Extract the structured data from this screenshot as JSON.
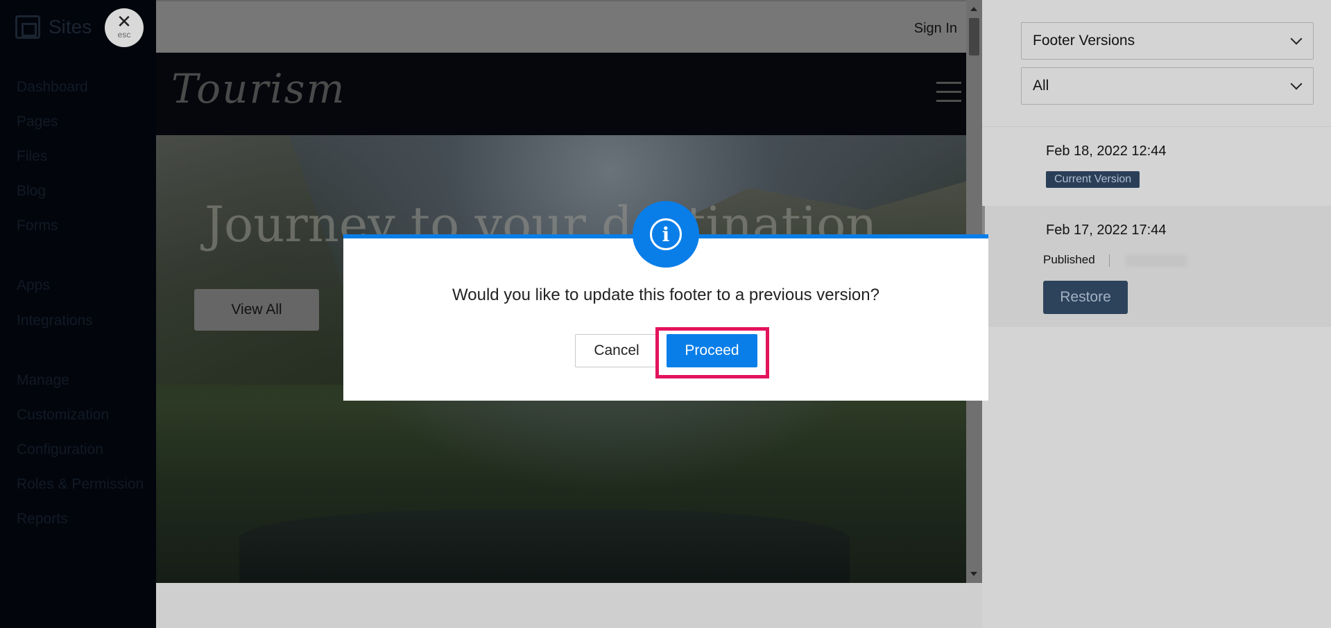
{
  "sidebar": {
    "brand": "Sites",
    "esc_icon_glyph": "✕",
    "esc_label": "esc",
    "items": [
      {
        "label": "Dashboard"
      },
      {
        "label": "Pages"
      },
      {
        "label": "Files"
      },
      {
        "label": "Blog"
      },
      {
        "label": "Forms"
      },
      {
        "label": "Apps"
      },
      {
        "label": "Integrations"
      },
      {
        "label": "Manage"
      },
      {
        "label": "Customization"
      },
      {
        "label": "Configuration"
      },
      {
        "label": "Roles & Permission"
      },
      {
        "label": "Reports"
      }
    ]
  },
  "preview": {
    "sign_in": "Sign In",
    "site_title": "Tourism",
    "hero_title": "Journey to your destination",
    "view_all": "View All"
  },
  "panel": {
    "footer_versions_select": "Footer Versions",
    "filter_select": "All",
    "versions": [
      {
        "date": "Feb 18, 2022 12:44",
        "badge": "Current Version"
      },
      {
        "date": "Feb 17, 2022 17:44",
        "status": "Published",
        "action": "Restore"
      }
    ]
  },
  "modal": {
    "icon": "info-icon",
    "icon_glyph": "i",
    "message": "Would you like to update this footer to a previous version?",
    "cancel": "Cancel",
    "proceed": "Proceed",
    "accent_color": "#0a7ee8",
    "highlight_color": "#e3135c"
  }
}
